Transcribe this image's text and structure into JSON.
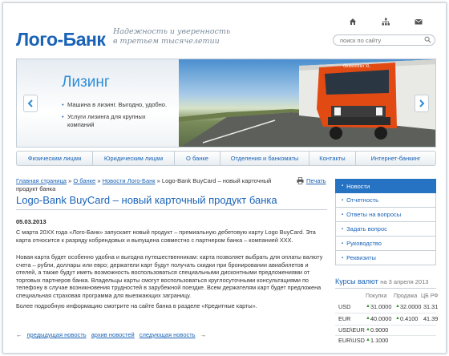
{
  "header": {
    "logo": "Лого-Банк",
    "slogan": "Надежность и уверенность в третьем тысячелетии",
    "icons": [
      "home-icon",
      "sitemap-icon",
      "mail-icon"
    ],
    "search_placeholder": "поиск по сайту"
  },
  "banner": {
    "title": "Лизинг",
    "items": [
      "Машина в лизинг. Выгодно, удобно.",
      "Услуги лизинга для крупных компаний"
    ],
    "truck_text": "Globetrotter XL"
  },
  "nav": {
    "items": [
      "Физическим лицам",
      "Юридическим лицам",
      "О банке",
      "Отделения и банкоматы",
      "Контакты",
      "Интернет-банкинг"
    ]
  },
  "breadcrumb": {
    "home": "Главная страница",
    "about": "О банке",
    "news": "Новости Лого-Банк",
    "current": "Logo-Bank BuyCard – новый карточный продукт банка",
    "sep": "»"
  },
  "print_label": "Печать",
  "article": {
    "title": "Logo-Bank BuyCard – новый карточный продукт банка",
    "date": "05.03.2013",
    "p1": "С  марта  20ХХ года «Лого-Банк» запускает новый продукт – премиальную дебетовую карту Logo BuyCard. Эта карта относится к разряду кобрендовых и выпущена совместно с партнером банка – компанией ХХХ.",
    "p2": "Новая карта будет особенно удобна и выгодна путешественникам: карта позволяет выбрать для оплаты валюту счета –  рубли, доллары или евро; держатели карт будут получать скидки при бронировании авиабилетов и отелей, а также будут иметь возможность воспользоваться специальными дисконтными предложениями от  торговых партнеров банка. Владельцы карты смогут воспользоваться круглосуточными консультациями по телефону в случае возникновения трудностей в зарубежной поездке. Всем держателям карт будет предложена специальная страховая программа для выезжающих заграницу.",
    "p3": "Более подробную информацию смотрите на сайте банка в разделе «Кредитные карты»."
  },
  "pager": {
    "prev": "предыдущая новость",
    "archive": "архив новостей",
    "next": "следующая новость"
  },
  "sidebar": {
    "items": [
      "Новости",
      "Отчетность",
      "Ответы на вопросы",
      "Задать вопрос",
      "Руководство",
      "Реквизиты"
    ]
  },
  "rates": {
    "title": "Курсы валют",
    "date_text": "на 3 апреля 2013",
    "headers": [
      "Покупка",
      "Продажа",
      "ЦБ РФ"
    ],
    "rows": [
      {
        "currency": "USD",
        "buy": "31.0000",
        "sell": "32.0000",
        "cb": "31.31",
        "buy_dir": "up",
        "sell_dir": "up"
      },
      {
        "currency": "EUR",
        "buy": "40.0000",
        "sell": "0.4100",
        "cb": "41.39",
        "buy_dir": "up",
        "sell_dir": "up"
      },
      {
        "currency": "USD\\EUR",
        "buy": "0.9000",
        "buy_dir": "up"
      },
      {
        "currency": "EUR\\USD",
        "buy": "1.1000",
        "buy_dir": "up"
      }
    ]
  },
  "colors": {
    "brand_blue": "#1a63b7",
    "active_blue": "#2673c3",
    "up_green": "#3a9a35"
  }
}
